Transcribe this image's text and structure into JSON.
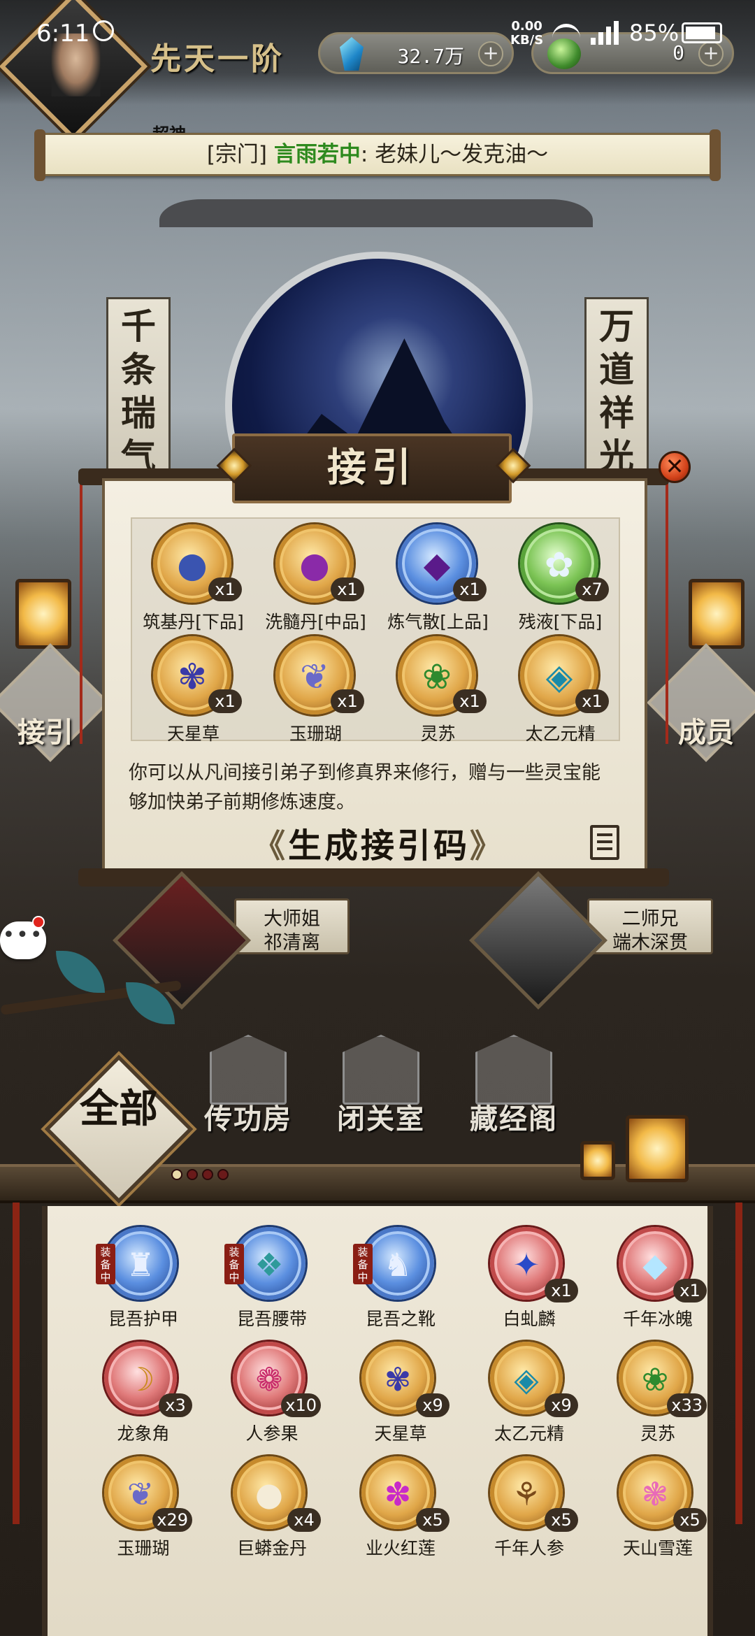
{
  "status_bar": {
    "time": "6:11",
    "net_speed": "0.00",
    "net_unit": "KB/S",
    "network_type": "4G",
    "battery": "85%",
    "icons": [
      "alarm-icon",
      "wifi-icon",
      "signal-icon",
      "battery-icon"
    ]
  },
  "hud": {
    "realm": "先天一阶",
    "currency": [
      {
        "icon": "spirit-stone-icon",
        "value": "32.7万"
      },
      {
        "icon": "jade-icon",
        "value": "0"
      }
    ],
    "partial_name": "超神"
  },
  "banner": {
    "channel": "[宗门]",
    "sender": "言雨若中",
    "separator": ": ",
    "message": "老妹儿～发克油～"
  },
  "scene": {
    "couplet_left": [
      "千",
      "条",
      "瑞",
      "气"
    ],
    "couplet_right": [
      "万",
      "道",
      "祥",
      "光"
    ],
    "left_button": "接引",
    "right_button": "成员"
  },
  "modal": {
    "title": "接引",
    "rewards": [
      {
        "name": "筑基丹[下品]",
        "qty": "x1",
        "glyph": "●",
        "rarity": "gold"
      },
      {
        "name": "洗髓丹[中品]",
        "qty": "x1",
        "glyph": "●",
        "rarity": "gold"
      },
      {
        "name": "炼气散[上品]",
        "qty": "x1",
        "glyph": "◆",
        "rarity": "blue"
      },
      {
        "name": "残液[下品]",
        "qty": "x7",
        "glyph": "✿",
        "rarity": "green"
      },
      {
        "name": "天星草",
        "qty": "x1",
        "glyph": "✾",
        "rarity": "gold"
      },
      {
        "name": "玉珊瑚",
        "qty": "x1",
        "glyph": "❦",
        "rarity": "gold"
      },
      {
        "name": "灵苏",
        "qty": "x1",
        "glyph": "❀",
        "rarity": "gold"
      },
      {
        "name": "太乙元精",
        "qty": "x1",
        "glyph": "◈",
        "rarity": "gold"
      }
    ],
    "description": "你可以从凡间接引弟子到修真界来修行，赠与一些灵宝能够加快弟子前期修炼速度。",
    "button_label": "生成接引码",
    "arrow_left": "《",
    "arrow_right": "》"
  },
  "disciples": [
    {
      "title": "大师姐",
      "name": "祁清离"
    },
    {
      "title": "二师兄",
      "name": "端木深贯"
    }
  ],
  "chat_bubble": "•••",
  "tabs": {
    "all": "全部",
    "buildings": [
      "传功房",
      "闭关室",
      "藏经阁"
    ]
  },
  "inventory": {
    "equipped_label": "装备中",
    "items": [
      {
        "name": "昆吾护甲",
        "qty": "",
        "equipped": true,
        "glyph": "♜",
        "rarity": "blue"
      },
      {
        "name": "昆吾腰带",
        "qty": "",
        "equipped": true,
        "glyph": "❖",
        "rarity": "blue"
      },
      {
        "name": "昆吾之靴",
        "qty": "",
        "equipped": true,
        "glyph": "♞",
        "rarity": "blue"
      },
      {
        "name": "白虬麟",
        "qty": "x1",
        "equipped": false,
        "glyph": "✦",
        "rarity": "red"
      },
      {
        "name": "千年冰魄",
        "qty": "x1",
        "equipped": false,
        "glyph": "◆",
        "rarity": "red"
      },
      {
        "name": "龙象角",
        "qty": "x3",
        "equipped": false,
        "glyph": "☽",
        "rarity": "red"
      },
      {
        "name": "人参果",
        "qty": "x10",
        "equipped": false,
        "glyph": "❁",
        "rarity": "red"
      },
      {
        "name": "天星草",
        "qty": "x9",
        "equipped": false,
        "glyph": "✾",
        "rarity": "gold"
      },
      {
        "name": "太乙元精",
        "qty": "x9",
        "equipped": false,
        "glyph": "◈",
        "rarity": "gold"
      },
      {
        "name": "灵苏",
        "qty": "x33",
        "equipped": false,
        "glyph": "❀",
        "rarity": "gold"
      },
      {
        "name": "玉珊瑚",
        "qty": "x29",
        "equipped": false,
        "glyph": "❦",
        "rarity": "gold"
      },
      {
        "name": "巨蟒金丹",
        "qty": "x4",
        "equipped": false,
        "glyph": "●",
        "rarity": "gold"
      },
      {
        "name": "业火红莲",
        "qty": "x5",
        "equipped": false,
        "glyph": "✽",
        "rarity": "gold"
      },
      {
        "name": "千年人参",
        "qty": "x5",
        "equipped": false,
        "glyph": "⚘",
        "rarity": "gold"
      },
      {
        "name": "天山雪莲",
        "qty": "x5",
        "equipped": false,
        "glyph": "❃",
        "rarity": "gold"
      }
    ]
  }
}
